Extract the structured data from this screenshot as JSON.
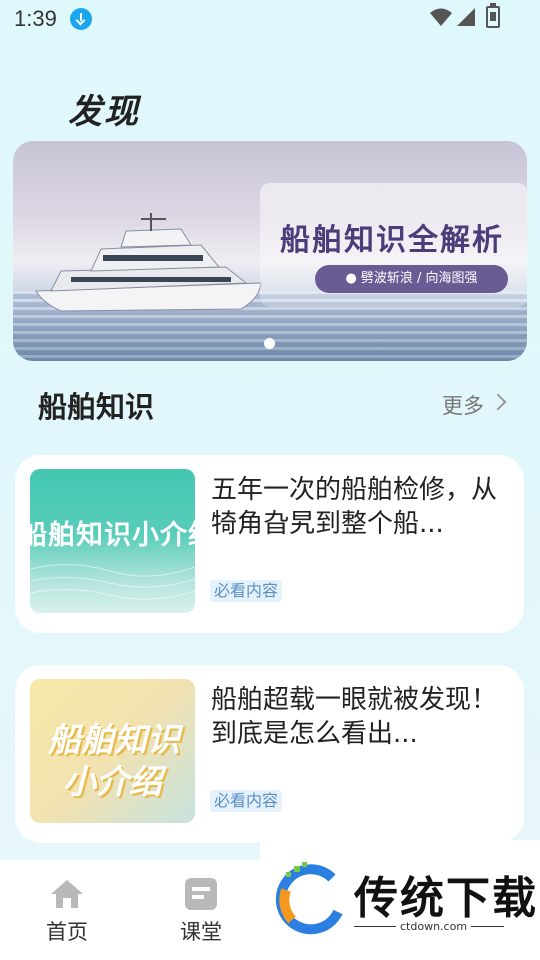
{
  "status_bar": {
    "time": "1:39"
  },
  "header": {
    "title": "发现"
  },
  "banner": {
    "title": "船舶知识全解析",
    "subtitle": "● 劈波斩浪 / 向海图强"
  },
  "section": {
    "title": "船舶知识",
    "more_label": "更多"
  },
  "articles": [
    {
      "thumb_text": "船舶知识小介绍",
      "title": "五年一次的船舶检修，从犄角旮旯到整个船...",
      "tag": "必看内容"
    },
    {
      "thumb_text_line1": "船舶知识",
      "thumb_text_line2": "小介绍",
      "title": "船舶超载一眼就被发现！到底是怎么看出...",
      "tag": "必看内容"
    }
  ],
  "bottom_nav": [
    {
      "label": "首页",
      "icon": "home-icon"
    },
    {
      "label": "课堂",
      "icon": "classroom-icon"
    }
  ],
  "watermark": {
    "text": "传统下载",
    "url": "ctdown.com"
  }
}
